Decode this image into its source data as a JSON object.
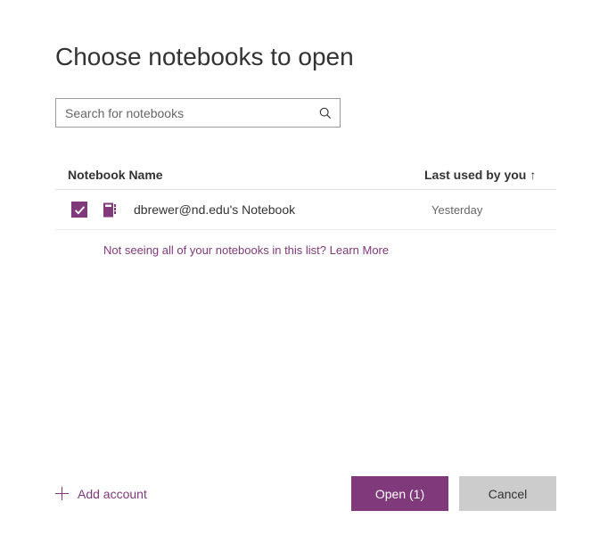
{
  "title": "Choose notebooks to open",
  "search": {
    "placeholder": "Search for notebooks"
  },
  "columns": {
    "name": "Notebook Name",
    "lastused": "Last used by you",
    "sort_indicator": "↑"
  },
  "notebooks": [
    {
      "name": "dbrewer@nd.edu's Notebook",
      "lastused": "Yesterday",
      "checked": true
    }
  ],
  "help_text": "Not seeing all of your notebooks in this list? Learn More",
  "footer": {
    "add_account": "Add account",
    "open_button": "Open (1)",
    "cancel_button": "Cancel"
  },
  "colors": {
    "accent": "#80397B"
  }
}
